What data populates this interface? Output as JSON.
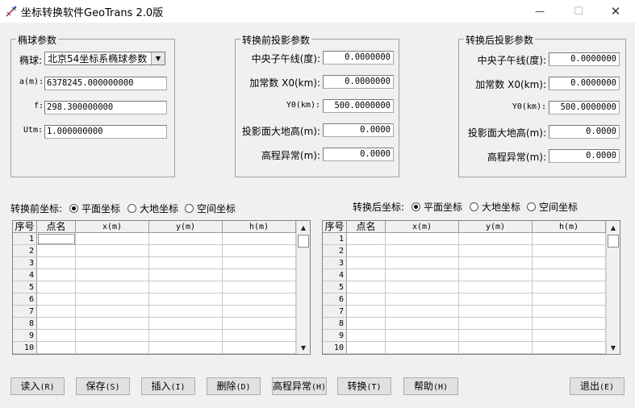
{
  "window": {
    "title": "坐标转换软件GeoTrans 2.0版",
    "controls": {
      "minimize": "—",
      "maximize": "☐",
      "close": "✕"
    }
  },
  "ellipsoid_group": {
    "title": "椭球参数",
    "ellipsoid_label": "椭球:",
    "ellipsoid_value": "北京54坐标系椭球参数",
    "a_label": "a(m):",
    "a_value": "6378245.000000000",
    "f_label": "f:",
    "f_value": "298.300000000",
    "utm_label": "Utm:",
    "utm_value": "1.000000000"
  },
  "before_proj": {
    "title": "转换前投影参数",
    "meridian_label": "中央子午线(度):",
    "meridian_value": "0.0000000",
    "x0_label": "加常数 X0(km):",
    "x0_value": "0.0000000",
    "y0_label": "Y0(km):",
    "y0_value": "500.0000000",
    "height_label": "投影面大地高(m):",
    "height_value": "0.0000",
    "anomaly_label": "高程异常(m):",
    "anomaly_value": "0.0000"
  },
  "after_proj": {
    "title": "转换后投影参数",
    "meridian_label": "中央子午线(度):",
    "meridian_value": "0.0000000",
    "x0_label": "加常数 X0(km):",
    "x0_value": "0.0000000",
    "y0_label": "Y0(km):",
    "y0_value": "500.0000000",
    "height_label": "投影面大地高(m):",
    "height_value": "0.0000",
    "anomaly_label": "高程异常(m):",
    "anomaly_value": "0.0000"
  },
  "before_coords": {
    "label": "转换前坐标:",
    "options": [
      "平面坐标",
      "大地坐标",
      "空间坐标"
    ],
    "selected": 0
  },
  "after_coords": {
    "label": "转换后坐标:",
    "options": [
      "平面坐标",
      "大地坐标",
      "空间坐标"
    ],
    "selected": 0
  },
  "grid": {
    "columns": [
      "序号",
      "点名",
      "x(m)",
      "y(m)",
      "h(m)"
    ],
    "rows": [
      "1",
      "2",
      "3",
      "4",
      "5",
      "6",
      "7",
      "8",
      "9",
      "10"
    ]
  },
  "buttons": {
    "read": [
      "读入",
      "(R)"
    ],
    "save": [
      "保存",
      "(S)"
    ],
    "insert": [
      "插入",
      "(I)"
    ],
    "delete": [
      "删除",
      "(D)"
    ],
    "height_anomaly": [
      "高程异常",
      "(H)"
    ],
    "convert": [
      "转换",
      "(T)"
    ],
    "help": [
      "帮助",
      "(H)"
    ],
    "exit": [
      "退出",
      "(E)"
    ]
  }
}
